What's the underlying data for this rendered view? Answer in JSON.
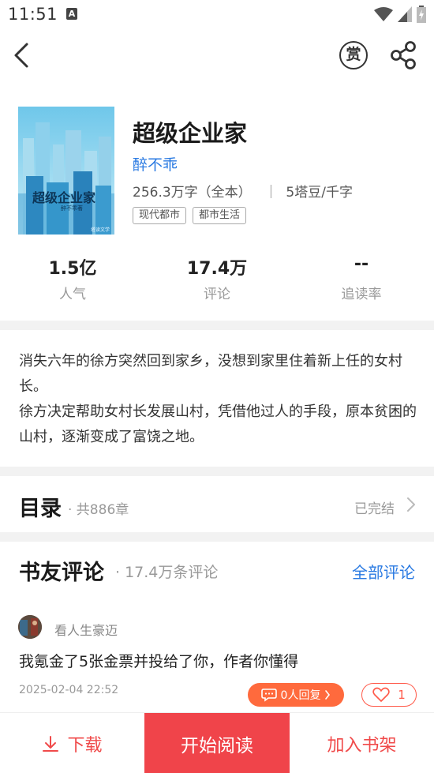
{
  "status_bar": {
    "time": "11:51",
    "notification_icon": "A"
  },
  "nav": {
    "reward_label": "赏"
  },
  "book": {
    "title": "超级企业家",
    "author": "醉不乖",
    "word_count": "256.3万字（全本）",
    "price": "5塔豆/千字",
    "tags": [
      "现代都市",
      "都市生活"
    ],
    "cover": {
      "title": "超级企业家",
      "author": "醉不乖著",
      "publisher": "塔读文学"
    }
  },
  "stats": [
    {
      "value": "1.5亿",
      "label": "人气"
    },
    {
      "value": "17.4万",
      "label": "评论"
    },
    {
      "value": "--",
      "label": "追读率"
    }
  ],
  "description": [
    "消失六年的徐方突然回到家乡，没想到家里住着新上任的女村长。",
    "徐方决定帮助女村长发展山村，凭借他过人的手段，原本贫困的山村，逐渐变成了富饶之地。"
  ],
  "catalog": {
    "title": "目录",
    "count": "· 共886章",
    "status": "已完结"
  },
  "reviews": {
    "title": "书友评论",
    "count": "· 17.4万条评论",
    "all_label": "全部评论",
    "items": [
      {
        "user": "看人生豪迈",
        "text": "我氪金了5张金票并投给了你，作者你懂得",
        "date": "2025-02-04 22:52",
        "reply_label": "0人回复",
        "likes": "1"
      }
    ]
  },
  "bottom_bar": {
    "download_label": "下载",
    "read_label": "开始阅读",
    "shelf_label": "加入书架"
  },
  "colors": {
    "accent_red": "#f0444a",
    "link_blue": "#2a7ae2",
    "reply_orange": "#ff6a3d"
  }
}
